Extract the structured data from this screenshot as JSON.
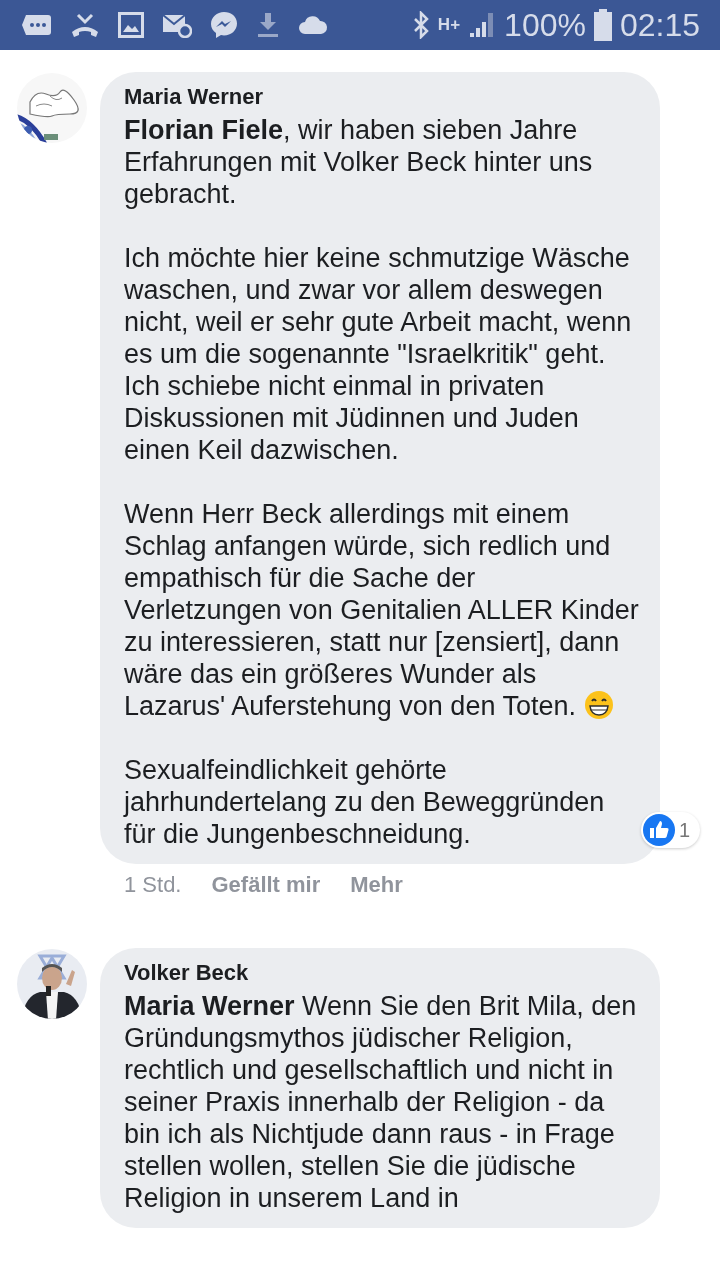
{
  "status_bar": {
    "network": "H+",
    "battery": "100%",
    "time": "02:15"
  },
  "comments": [
    {
      "author": "Maria Werner",
      "avatar": {
        "kind": "picture"
      },
      "paragraphs": [
        {
          "text": "**Florian Fiele**, wir haben sieben Jahre Erfahrungen mit Volker Beck hinter uns gebracht.",
          "emoji": false
        },
        {
          "text": "Ich möchte hier keine schmutzige Wäsche waschen, und zwar vor allem deswegen nicht, weil er sehr gute Arbeit macht, wenn es um die sogenannte \"Israelkritik\" geht. Ich schiebe nicht einmal in privaten Diskussionen mit Jüdinnen und Juden einen Keil dazwischen.",
          "emoji": false
        },
        {
          "text": "Wenn Herr Beck allerdings mit einem Schlag anfangen würde, sich redlich und empathisch für die Sache der Verletzungen von Genitalien ALLER Kinder zu interessieren, statt nur [zensiert], dann wäre das ein größeres Wunder als Lazarus' Auferstehung von den Toten.",
          "emoji": true
        },
        {
          "text": "Sexualfeindlichkeit gehörte jahrhundertelang zu den Beweggründen für die Jungenbeschneidung.",
          "emoji": false
        }
      ],
      "reactions": "1",
      "time": "1 Std.",
      "actions": [
        "Gefällt mir",
        "Mehr"
      ]
    },
    {
      "author": "Volker Beck",
      "avatar": {
        "kind": "picture"
      },
      "paragraphs": [
        {
          "text": "**Maria Werner** Wenn Sie den Brit Mila, den Gründungsmythos jüdischer Religion, rechtlich und gesellschaftlich und nicht in seiner Praxis innerhalb der Religion - da bin ich als Nichtjude dann raus - in Frage stellen wollen, stellen Sie die jüdische Religion in unserem Land in",
          "emoji": false
        }
      ]
    }
  ]
}
